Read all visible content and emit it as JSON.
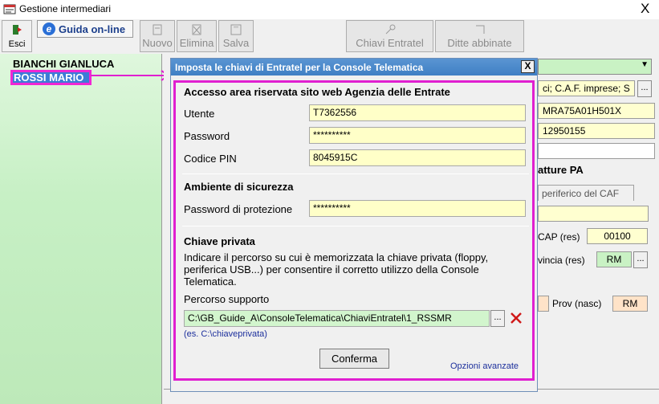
{
  "window": {
    "title": "Gestione intermediari",
    "close_glyph": "X"
  },
  "toolbar": {
    "exit_label": "Esci",
    "guide_label": "Guida on-line",
    "new_label": "Nuovo",
    "delete_label": "Elimina",
    "save_label": "Salva",
    "keys_label": "Chiavi Entratel",
    "linked_label": "Ditte abbinate"
  },
  "intermediari": [
    {
      "name": "BIANCHI GIANLUCA"
    },
    {
      "name": "ROSSI MARIO"
    }
  ],
  "background_form": {
    "type_value": "ci; C.A.F. imprese; S",
    "ellipsis": "...",
    "codice_fiscale": "MRA75A01H501X",
    "partita_iva": "12950155",
    "section_title": "atture PA",
    "tab_label": "periferico del CAF",
    "cap_label": "CAP (res)",
    "cap_value": "00100",
    "provincia_label": "vincia (res)",
    "provincia_value": "RM",
    "prov_nasc_label": "Prov (nasc)",
    "prov_nasc_value": "RM"
  },
  "dialog": {
    "title": "Imposta le chiavi di Entratel per la Console Telematica",
    "close_label": "X",
    "section_access": {
      "heading": "Accesso area riservata sito web Agenzia delle Entrate",
      "user_label": "Utente",
      "user_value": "T7362556",
      "password_label": "Password",
      "password_value": "**********",
      "pin_label": "Codice PIN",
      "pin_value": "8045915C"
    },
    "section_security": {
      "heading": "Ambiente di sicurezza",
      "protection_label": "Password di protezione",
      "protection_value": "**********"
    },
    "section_key": {
      "heading": "Chiave privata",
      "description": "Indicare il percorso su cui è memorizzata la chiave privata (floppy, periferica USB...) per consentire il corretto utilizzo della Console Telematica.",
      "path_label": "Percorso supporto",
      "path_value": "C:\\GB_Guide_A\\ConsoleTelematica\\ChiaviEntratel\\1_RSSMR",
      "browse_label": "...",
      "example": "(es. C:\\chiaveprivata)"
    },
    "confirm_label": "Conferma",
    "advanced_label": "Opzioni avanzate"
  },
  "colors": {
    "highlight": "#e01fd0",
    "selection": "#3d7bd6",
    "title_blue": "#3f7fc4",
    "input_yellow": "#ffffc8",
    "list_green": "#c7f0c5"
  }
}
